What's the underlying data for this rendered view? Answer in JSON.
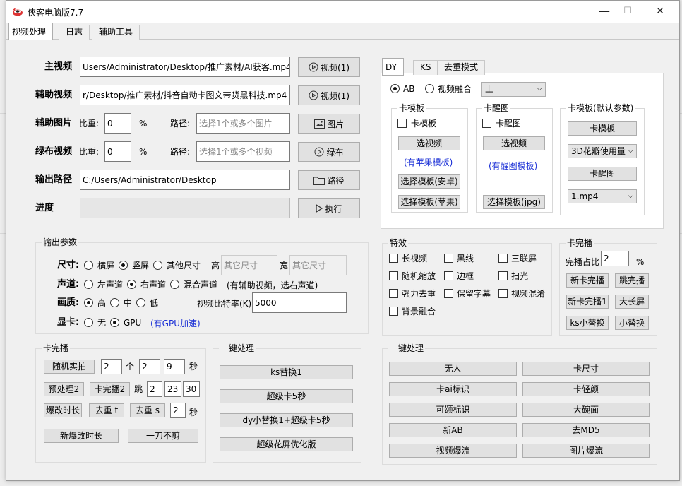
{
  "window": {
    "title": "侠客电脑版7.7",
    "min": "—",
    "max": "☐",
    "close": "✕"
  },
  "tabs": [
    "视频处理",
    "日志",
    "辅助工具"
  ],
  "main": {
    "label": "主视频",
    "value": "Users/Administrator/Desktop/推广素材/AI获客.mp4",
    "button": "视频(1)"
  },
  "aux": {
    "label": "辅助视频",
    "value": "r/Desktop/推广素材/抖音自动卡图文带货黑科技.mp4",
    "button": "视频(1)"
  },
  "auximg": {
    "label": "辅助图片",
    "ratio_label": "比重:",
    "ratio": "0",
    "pct": "%",
    "path_label": "路径:",
    "placeholder": "选择1个或多个图片",
    "button": "图片"
  },
  "green": {
    "label": "绿布视频",
    "ratio_label": "比重:",
    "ratio": "0",
    "pct": "%",
    "path_label": "路径:",
    "placeholder": "选择1个或多个视频",
    "button": "绿布"
  },
  "output": {
    "label": "输出路径",
    "value": "C:/Users/Administrator/Desktop",
    "button": "路径"
  },
  "progress": {
    "label": "进度",
    "value": 0,
    "button": "执行"
  },
  "params": {
    "title": "输出参数",
    "size": {
      "label": "尺寸:",
      "opts": [
        "横屏",
        "竖屏",
        "其他尺寸"
      ],
      "h": "高",
      "w": "宽",
      "h_ph": "其它尺寸",
      "w_ph": "其它尺寸"
    },
    "audio": {
      "label": "声道:",
      "opts": [
        "左声道",
        "右声道",
        "混合声道"
      ],
      "note": "(有辅助视频，选右声道)"
    },
    "quality": {
      "label": "画质:",
      "opts": [
        "高",
        "中",
        "低"
      ],
      "bitrate_label": "视频比特率(K)",
      "bitrate": "5000"
    },
    "gpu": {
      "label": "显卡:",
      "opts": [
        "无",
        "GPU"
      ],
      "note": "(有GPU加速)"
    }
  },
  "right_tabs": [
    "DY",
    "KS",
    "去重模式"
  ],
  "mode": {
    "opts": [
      "AB",
      "视频融合"
    ],
    "select": "上"
  },
  "kamb": {
    "title": "卡模板",
    "check": "卡模板",
    "btn": "选视频",
    "note": "(有苹果模板)",
    "btn2": "选择模板(安卓)",
    "btn3": "选择模板(苹果)"
  },
  "kaxt": {
    "title": "卡醒图",
    "check": "卡醒图",
    "btn": "选视频",
    "note": "(有醒图模板)",
    "btn2": "选择模板(jpg)"
  },
  "kamb_def": {
    "title": "卡模板(默认参数)",
    "btn1": "卡模板",
    "select1": "3D花瓣使用量",
    "btn2": "卡醒图",
    "select2": "1.mp4"
  },
  "effects": {
    "title": "特效",
    "items": [
      "长视频",
      "黑线",
      "三联屏",
      "随机缩放",
      "边框",
      "扫光",
      "强力去重",
      "保留字幕",
      "视频混淆",
      "背景融合"
    ]
  },
  "kawb_r": {
    "title": "卡完播",
    "ratio_label": "完播占比",
    "ratio": "2",
    "pct": "%",
    "btns": [
      "新卡完播",
      "跳完播",
      "新卡完播1",
      "大长屏",
      "ks小替换",
      "小替换"
    ]
  },
  "kawb_l": {
    "title": "卡完播",
    "random_btn": "随机实拍",
    "n1": "2",
    "ge": "个",
    "n2": "2",
    "n3": "9",
    "sec": "秒",
    "pre_btn": "预处理2",
    "ka2_btn": "卡完播2",
    "tiao": "跳",
    "j1": "2",
    "j2": "23",
    "j3": "30",
    "bg_btn": "爆改时长",
    "qt_btn": "去重 t",
    "qs_btn": "去重 s",
    "qs_n": "2",
    "sec2": "秒",
    "new_btn": "新爆改时长",
    "cut_btn": "一刀不剪"
  },
  "onekey1": {
    "title": "一键处理",
    "btns": [
      "ks替换1",
      "超级卡5秒",
      "dy小替换1+超级卡5秒",
      "超级花屏优化版"
    ]
  },
  "onekey2": {
    "title": "一键处理",
    "btns": [
      "无人",
      "卡尺寸",
      "卡ai标识",
      "卡轻颜",
      "可颂标识",
      "大碗面",
      "新AB",
      "去MD5",
      "视频爆流",
      "图片爆流"
    ]
  },
  "colors": {
    "blue_note": "#1a2fd6",
    "title_bg": "#ffffff",
    "progress": "#06b025"
  }
}
